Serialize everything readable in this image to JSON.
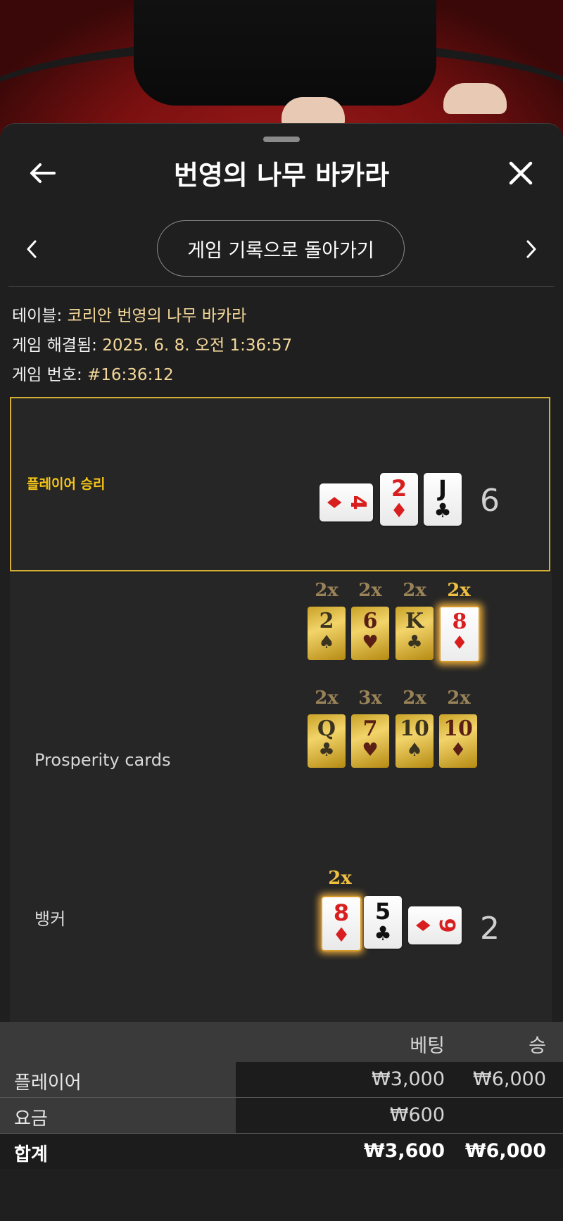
{
  "header": {
    "title": "번영의 나무 바카라"
  },
  "nav": {
    "back_to_history": "게임 기록으로 돌아가기"
  },
  "info": {
    "table_label": "테이블:",
    "table_value": "코리안 번영의 나무 바카라",
    "resolved_label": "게임 해결됨:",
    "resolved_value": "2025. 6. 8. 오전 1:36:57",
    "game_no_label": "게임 번호:",
    "game_no_value": "#16:36:12"
  },
  "player": {
    "result": "플레이어 승리",
    "score": "6",
    "cards": [
      {
        "rank": "4",
        "suit": "♦",
        "color": "red",
        "orientation": "sideways"
      },
      {
        "rank": "2",
        "suit": "♦",
        "color": "red"
      },
      {
        "rank": "J",
        "suit": "♣",
        "color": "black"
      }
    ]
  },
  "prosperity": {
    "label": "Prosperity cards",
    "row1": [
      {
        "mult": "2x",
        "rank": "2",
        "suit": "♠",
        "highlight": false
      },
      {
        "mult": "2x",
        "rank": "6",
        "suit": "♥",
        "highlight": false
      },
      {
        "mult": "2x",
        "rank": "K",
        "suit": "♣",
        "highlight": false
      },
      {
        "mult": "2x",
        "rank": "8",
        "suit": "♦",
        "highlight": true
      }
    ],
    "row2": [
      {
        "mult": "2x",
        "rank": "Q",
        "suit": "♣",
        "highlight": false
      },
      {
        "mult": "3x",
        "rank": "7",
        "suit": "♥",
        "highlight": false
      },
      {
        "mult": "2x",
        "rank": "10",
        "suit": "♠",
        "highlight": false
      },
      {
        "mult": "2x",
        "rank": "10",
        "suit": "♦",
        "highlight": false
      }
    ]
  },
  "banker": {
    "label": "뱅커",
    "score": "2",
    "mult": "2x",
    "cards": [
      {
        "rank": "8",
        "suit": "♦",
        "color": "red",
        "highlight": true
      },
      {
        "rank": "5",
        "suit": "♣",
        "color": "black"
      },
      {
        "rank": "9",
        "suit": "♦",
        "color": "red",
        "orientation": "sideways"
      }
    ]
  },
  "bets": {
    "col_bet": "베팅",
    "col_win": "승",
    "rows": [
      {
        "label": "플레이어",
        "bet": "₩3,000",
        "win": "₩6,000"
      },
      {
        "label": "요금",
        "bet": "₩600",
        "win": ""
      }
    ],
    "total": {
      "label": "합계",
      "bet": "₩3,600",
      "win": "₩6,000"
    }
  },
  "colors": {
    "accent_gold": "#d4af37",
    "value_text": "#f4d89a",
    "win_label": "#f5c518"
  }
}
